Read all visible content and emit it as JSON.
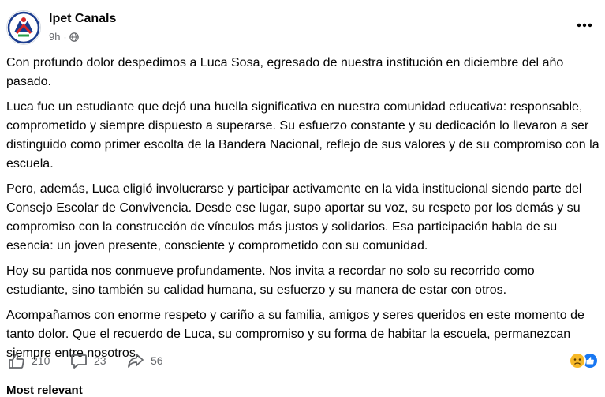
{
  "post": {
    "page_name": "Ipet Canals",
    "time": "9h",
    "dot": "·",
    "privacy_icon": "globe-icon",
    "more_icon": "more-dots-icon",
    "paragraphs": [
      "Con profundo dolor despedimos a Luca Sosa, egresado de nuestra institución en diciembre del año pasado.",
      "Luca fue un estudiante que dejó una huella significativa en nuestra comunidad educativa: responsable, comprometido y siempre dispuesto a superarse. Su esfuerzo constante y su dedicación lo llevaron a ser distinguido como primer escolta de la Bandera Nacional, reflejo de sus valores y de su compromiso con la escuela.",
      "Pero, además, Luca eligió involucrarse y participar activamente en la vida institucional siendo parte del Consejo Escolar de Convivencia. Desde ese lugar, supo aportar su voz, su respeto por los demás y su compromiso con la construcción de vínculos más justos y solidarios. Esa participación habla de su esencia: un joven presente, consciente y comprometido con su comunidad.",
      "Hoy su partida nos conmueve profundamente. Nos invita a recordar no solo su recorrido como estudiante, sino también su calidad humana, su esfuerzo y su manera de estar con otros.",
      "Acompañamos con enorme respeto y cariño a su familia, amigos y seres queridos en este momento de tanto dolor. Que el recuerdo de Luca, su compromiso y su forma de habitar la escuela, permanezcan siempre entre nosotros."
    ]
  },
  "actions": {
    "like_count": "210",
    "comment_count": "23",
    "share_count": "56",
    "like_icon": "thumbs-up-icon",
    "comment_icon": "comment-icon",
    "share_icon": "share-icon"
  },
  "reactions": {
    "sad_icon": "sad-reaction-icon",
    "like_icon": "like-reaction-icon"
  },
  "comments": {
    "sort_label": "Most relevant"
  },
  "colors": {
    "text": "#050505",
    "secondary": "#65676b",
    "brand_blue": "#1877f2",
    "reaction_yellow": "#f7b928"
  }
}
